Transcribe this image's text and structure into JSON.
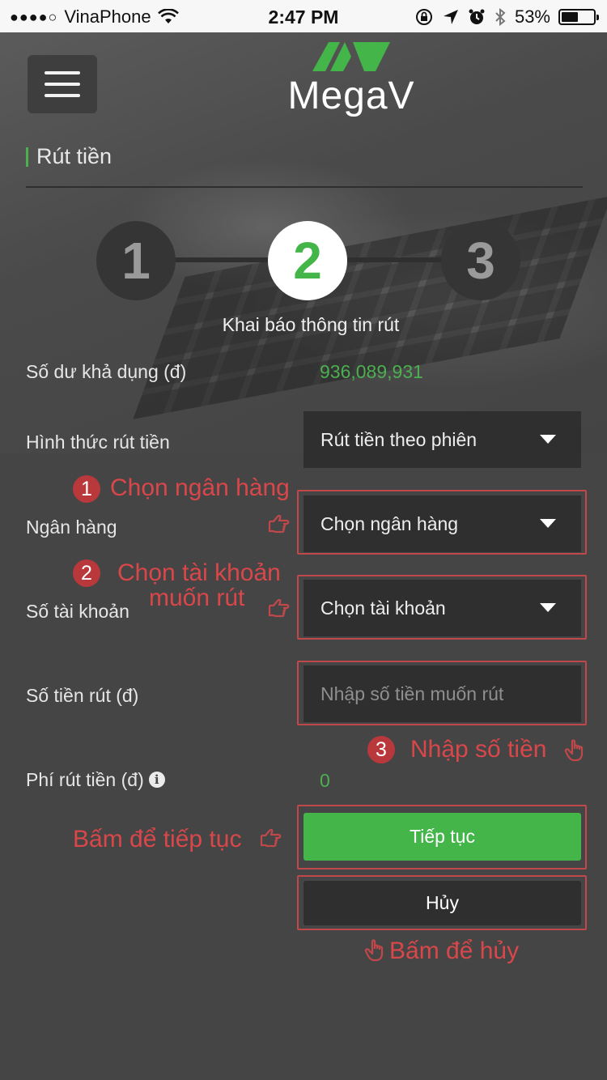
{
  "status_bar": {
    "signal": "●●●●○",
    "carrier": "VinaPhone",
    "time": "2:47 PM",
    "battery": "53%",
    "battery_level": 0.53
  },
  "header": {
    "logo_text": "MegaV",
    "brand_green": "#4caf50"
  },
  "page": {
    "title": "Rút tiền"
  },
  "steps": {
    "items": [
      "1",
      "2",
      "3"
    ],
    "active": 2,
    "caption": "Khai báo thông tin rút"
  },
  "form": {
    "balance_label": "Số dư khả dụng (đ)",
    "balance_value": "936,089,931",
    "method_label": "Hình thức rút tiền",
    "method_value": "Rút tiền theo phiên",
    "bank_label": "Ngân hàng",
    "bank_value": "Chọn ngân hàng",
    "account_label": "Số tài khoản",
    "account_value": "Chọn tài khoản",
    "amount_label": "Số tiền rút (đ)",
    "amount_placeholder": "Nhập số tiền muốn rút",
    "fee_label": "Phí rút tiền (đ)",
    "fee_value": "0",
    "continue_label": "Tiếp tục",
    "cancel_label": "Hủy"
  },
  "annotations": {
    "a1_num": "1",
    "a1_text": "Chọn ngân hàng",
    "a2_num": "2",
    "a2_line1": "Chọn tài khoản",
    "a2_line2": "muốn rút",
    "a3_num": "3",
    "a3_text": "Nhập số tiền",
    "continue_hint": "Bấm để tiếp tục",
    "cancel_hint": "Bấm để hủy",
    "color": "#d9474a"
  }
}
